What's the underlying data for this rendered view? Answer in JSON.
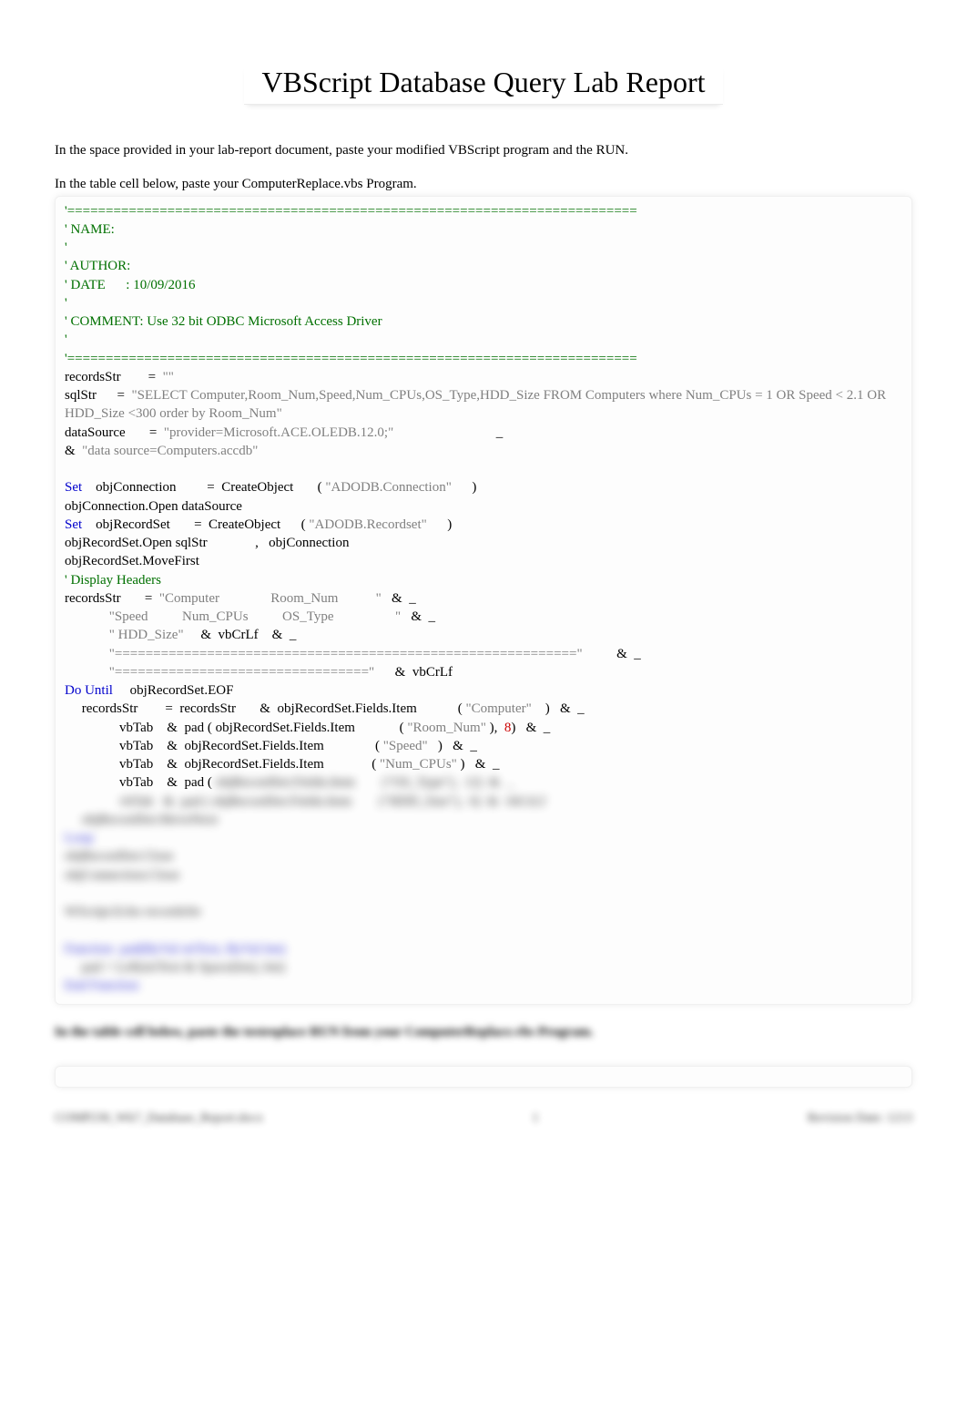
{
  "title": "VBScript Database Query Lab Report",
  "intro": "In the space provided in your lab-report document, paste your modified VBScript program and the RUN.",
  "instruction": "In the table cell below, paste your ComputerReplace.vbs Program.",
  "code": {
    "bar": "'==========================================================================",
    "name_label": "' NAME:",
    "tick": "'",
    "author_label": "' AUTHOR:",
    "date_line": "' DATE      : 10/09/2016",
    "comment_line": "' COMMENT: Use 32 bit ODBC Microsoft Access Driver",
    "recordsStr_decl_a": "recordsStr",
    "eq": "=",
    "empty_quotes": "\"\"",
    "sqlStr_name": "sqlStr",
    "sqlStr_val": "\"SELECT Computer,Room_Num,Speed,Num_CPUs,OS_Type,HDD_Size FROM Computers where Num_CPUs = 1 OR Speed < 2.1 OR HDD_Size <300 order by Room_Num\"",
    "dataSource_name": "dataSource",
    "dataSource_val1": "\"provider=Microsoft.ACE.OLEDB.12.0;\"",
    "dataSource_cont": "_",
    "amp": "&",
    "dataSource_val2": "\"data source=Computers.accdb\"",
    "set_kw": "Set",
    "objConn_name": "objConnection",
    "createObj": "CreateObject",
    "adodb_conn": "\"ADODB.Connection\"",
    "lp": "(",
    "rp": ")",
    "open_ds": "objConnection.Open dataSource",
    "objRS_name": "objRecordSet",
    "adodb_rs": "\"ADODB.Recordset\"",
    "rs_open": "objRecordSet.Open sqlStr",
    "comma": ",",
    "rs_open_conn": "objConnection",
    "rs_movefirst": "objRecordSet.MoveFirst",
    "disp_headers": "' Display Headers",
    "hdr1": "\"Computer               Room_Num           \"",
    "amp_cont": "&  _",
    "hdr2": "\"Speed          Num_CPUs          OS_Type                  \"",
    "hdr3": "\" HDD_Size\"",
    "vbcrlf": "vbCrLf",
    "hdr_sep1": "\"============================================================\"",
    "hdr_sep2": "\"=================================\"",
    "do_until": "Do Until",
    "rs_eof": "objRecordSet.EOF",
    "recordsStr2": "recordsStr",
    "rs_fields_item": "objRecordSet.Fields.Item",
    "fld_computer": "\"Computer\"",
    "vbTab": "vbTab",
    "pad_open": "pad (",
    "fld_room": "\"Room_Num\"",
    "eight": "8",
    "fld_speed": "\"Speed\"",
    "fld_numcpus": "\"Num_CPUs\"",
    "blur1": "objRecordSet.Fields.Item        (\"OS_Type\"),  12)  &  _",
    "blur2": "vbTab   &  pad ( objRecordSet.Fields.Item        (\"HDD_Size\"),  6)  &  vbCrLf",
    "blur3": "objRecordSet.MoveNext",
    "blur4": "Loop",
    "blur5": "objRecordSet.Close",
    "blur6": "objConnection.Close",
    "blur7": "WScript.Echo recordsStr",
    "blur_fn1": "Function  pad(ByVal strText, ByVal len)",
    "blur_fn2": "pad = Left(strText & Space(len), len)",
    "blur_fn3": "End Function"
  },
  "instruction2": "In the table cell below, paste the testreplace RUN from your ComputerReplace.vbs Program.",
  "footer": {
    "left": "COMP230_Wk7_Database_Report.docx",
    "center": "1",
    "right": "Revision Date: 1213"
  }
}
